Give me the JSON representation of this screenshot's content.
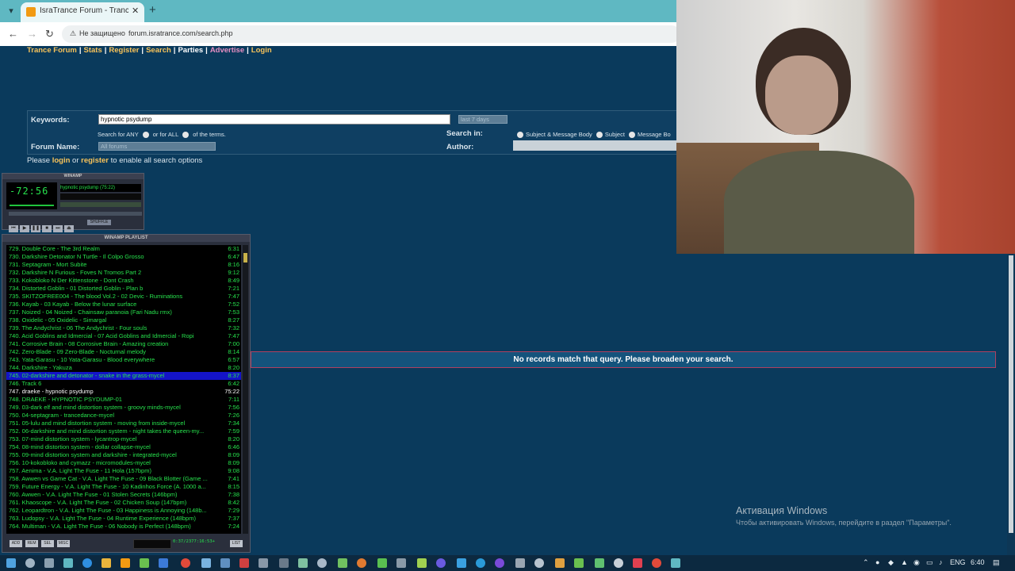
{
  "browser": {
    "tab_title": "IsraTrance Forum - Trance Forum",
    "security_label": "Не защищено",
    "url": "forum.isratrance.com/search.php"
  },
  "nav": {
    "items": [
      "Trance Forum",
      "Stats",
      "Register",
      "Search",
      "Parties",
      "Advertise",
      "Login"
    ]
  },
  "search": {
    "keywords_label": "Keywords:",
    "keywords_value": "hypnotic psydump",
    "date_range": "last 7 days",
    "search_for_any": "Search for ANY",
    "or_for_all": "or for ALL",
    "of_terms": "of the terms.",
    "search_in_label": "Search in:",
    "opt_subject_body": "Subject & Message Body",
    "opt_subject": "Subject",
    "opt_message": "Message Bo",
    "forum_name_label": "Forum Name:",
    "forum_value": "All forums",
    "author_label": "Author:",
    "login_prefix": "Please",
    "login_link": "login",
    "or": "or",
    "register_link": "register",
    "login_suffix": "to enable all search options"
  },
  "results": {
    "message": "No records match that query. Please broaden your search."
  },
  "winamp": {
    "title": "WINAMP",
    "time": "-72:56",
    "marquee": "hypnotic psydump (75:22)",
    "shuffle": "SHUFFLE",
    "playlist_title": "WINAMP PLAYLIST",
    "playlist_time": "0:37/2377:16:53+",
    "footer_buttons": [
      "ADD",
      "REM",
      "SEL",
      "MISC"
    ],
    "list_button": "LIST",
    "tracks": [
      {
        "name": "729. Double Core - The 3rd Realm",
        "dur": "6:31"
      },
      {
        "name": "730. Darkshire Detonator N Turtle - Il Colpo Grosso",
        "dur": "6:47"
      },
      {
        "name": "731. Septagram - Mort Subite",
        "dur": "8:16"
      },
      {
        "name": "732. Darkshire N Furious - Foves N Tromos Part 2",
        "dur": "9:12"
      },
      {
        "name": "733. Kokobloko N Der Kittenstone - Dont Crash",
        "dur": "8:49"
      },
      {
        "name": "734. Distorted Goblin - 01 Distorted Goblin - Plan b",
        "dur": "7:21"
      },
      {
        "name": "735. SKITZOFREE004 - The blood Vol.2 - 02 Devic - Ruminations",
        "dur": "7:47"
      },
      {
        "name": "736. Kayab - 03 Kayab - Below the lunar surface",
        "dur": "7:52"
      },
      {
        "name": "737. Noized - 04 Noized - Chainsaw paranoia (Fari Nadu rmx)",
        "dur": "7:53"
      },
      {
        "name": "738. Oxidelic - 05 Oxidelic - Simargal",
        "dur": "8:27"
      },
      {
        "name": "739. The Andychrist - 06 The Andychrist - Four souls",
        "dur": "7:32"
      },
      {
        "name": "740. Acid Goblins and Idmercial - 07 Acid Goblins and Idmercial - Ropi",
        "dur": "7:47"
      },
      {
        "name": "741. Corrosive Brain - 08 Corrosive Brain - Amazing creation",
        "dur": "7:00"
      },
      {
        "name": "742. Zero-Blade - 09 Zero-Blade - Nocturnal melody",
        "dur": "8:14"
      },
      {
        "name": "743. Yata-Garasu - 10 Yata-Garasu - Blood everywhere",
        "dur": "6:57"
      },
      {
        "name": "744. Darkshire - Yakuza",
        "dur": "8:20"
      },
      {
        "name": "745. 02-darkshire and detonator - snake in the grass-mycel",
        "dur": "8:37"
      },
      {
        "name": "746. Track 6",
        "dur": "6:42"
      },
      {
        "name": "747. draeke - hypnotic psydump",
        "dur": "75:22"
      },
      {
        "name": "748. DRAEKE - HYPNOTIC PSYDUMP-01",
        "dur": "7:11"
      },
      {
        "name": "749. 03-dark elf and mind distortion system - groovy minds-mycel",
        "dur": "7:56"
      },
      {
        "name": "750. 04-septagram - trancedance-mycel",
        "dur": "7:26"
      },
      {
        "name": "751. 05-lulu and mind distortion system - moving from inside-mycel",
        "dur": "7:34"
      },
      {
        "name": "752. 06-darkshire and mind distortion system - night takes the queen-my...",
        "dur": "7:59"
      },
      {
        "name": "753. 07-mind distortion system - lycantrop-mycel",
        "dur": "8:20"
      },
      {
        "name": "754. 08-mind distortion system - dollar collapse-mycel",
        "dur": "6:46"
      },
      {
        "name": "755. 09-mind distortion system and darkshire - integrated-mycel",
        "dur": "8:09"
      },
      {
        "name": "756. 10-kokobloko and cymazz - micromodules-mycel",
        "dur": "8:09"
      },
      {
        "name": "757. Aenima - V.A. Light The Fuse - 11 Hola (157bpm)",
        "dur": "9:08"
      },
      {
        "name": "758. Awwen vs Game Cat - V.A. Light The Fuse - 09 Black Blotter (Game ...",
        "dur": "7:41"
      },
      {
        "name": "759. Future Energy - V.A. Light The Fuse - 10 Kadinhos Force (A. 1000 a...",
        "dur": "8:15"
      },
      {
        "name": "760. Awwen - V.A. Light The Fuse - 01 Stolen Secrets (146bpm)",
        "dur": "7:38"
      },
      {
        "name": "761. Khaoscope - V.A. Light The Fuse - 02 Chicken Soup (147bpm)",
        "dur": "8:42"
      },
      {
        "name": "762. Leopardtron - V.A. Light The Fuse - 03 Happiness is Annoying (148b...",
        "dur": "7:29"
      },
      {
        "name": "763. Ludopsy - V.A. Light The Fuse - 04 Runtime Experience (148bpm)",
        "dur": "7:37"
      },
      {
        "name": "764. Multiman - V.A. Light The Fuse - 06 Nobody is Perfect (148bpm)",
        "dur": "7:24"
      }
    ]
  },
  "watermark": {
    "line1": "Активация Windows",
    "line2": "Чтобы активировать Windows, перейдите в раздел \"Параметры\"."
  },
  "taskbar": {
    "lang": "ENG",
    "time": "6:40"
  }
}
